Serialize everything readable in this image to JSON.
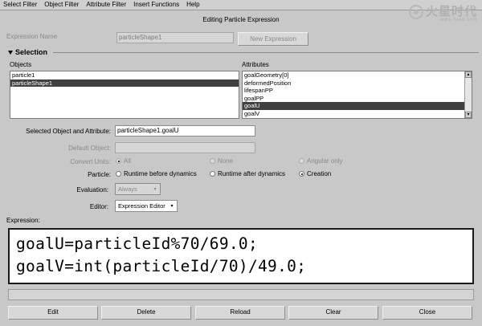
{
  "menubar": {
    "items": [
      "Select Filter",
      "Object Filter",
      "Attribute Filter",
      "Insert Functions",
      "Help"
    ]
  },
  "watermark": {
    "logo": "火星时代",
    "url": "www.hxsd.com"
  },
  "title": "Editing Particle Expression",
  "expression_name": {
    "label": "Expression Name",
    "value": "particleShape1",
    "button": "New Expression"
  },
  "selection": {
    "header": "Selection",
    "objects_label": "Objects",
    "attributes_label": "Attributes",
    "objects": [
      "particle1",
      "particleShape1"
    ],
    "objects_selected": 1,
    "attributes": [
      "goalGeometry[0]",
      "deformedPosition",
      "lifespanPP",
      "goalPP",
      "goalU",
      "goalV"
    ],
    "attributes_selected": 4
  },
  "form": {
    "selected_label": "Selected Object and Attribute:",
    "selected_value": "particleShape1.goalU",
    "default_label": "Default Object:",
    "default_value": "",
    "convert_label": "Convert Units:",
    "convert_options": [
      "All",
      "None",
      "Angular only"
    ],
    "particle_label": "Particle:",
    "particle_options": [
      "Runtime before dynamics",
      "Runtime after dynamics",
      "Creation"
    ],
    "evaluation_label": "Evaluation:",
    "evaluation_value": "Always",
    "editor_label": "Editor:",
    "editor_value": "Expression Editor"
  },
  "expression": {
    "label": "Expression:",
    "line1": "goalU=particleId%70/69.0;",
    "line2": "goalV=int(particleId/70)/49.0;"
  },
  "buttons": {
    "edit": "Edit",
    "delete": "Delete",
    "reload": "Reload",
    "clear": "Clear",
    "close": "Close"
  }
}
